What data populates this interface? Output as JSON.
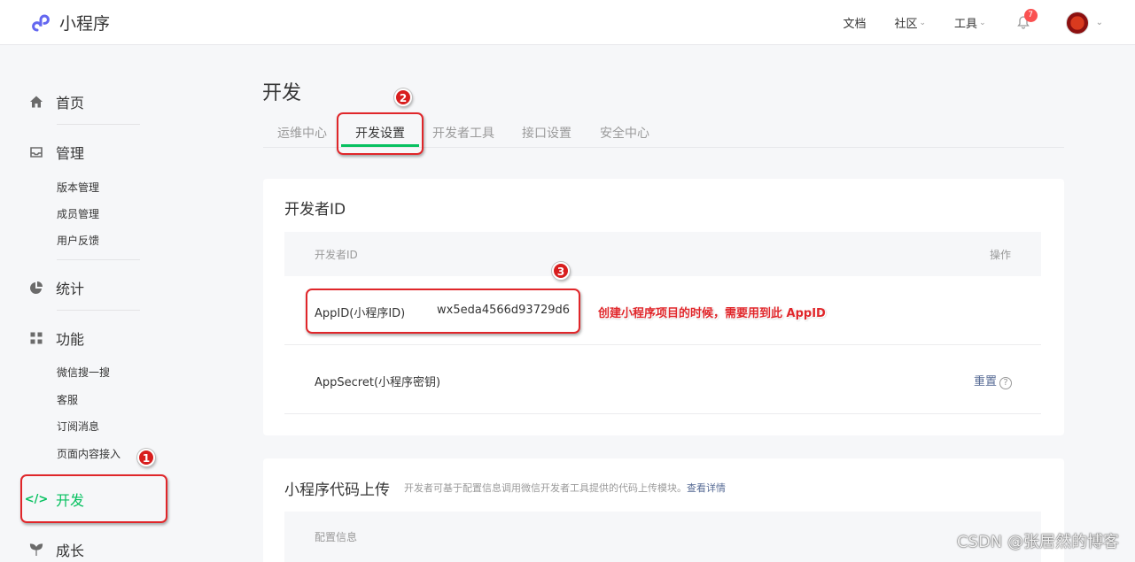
{
  "app": {
    "title": "小程序"
  },
  "topnav": {
    "docs": "文档",
    "community": "社区",
    "tools": "工具",
    "notification_count": "7"
  },
  "sidebar": {
    "home": "首页",
    "manage": "管理",
    "manage_items": [
      "版本管理",
      "成员管理",
      "用户反馈"
    ],
    "stats": "统计",
    "features": "功能",
    "feature_items": [
      "微信搜一搜",
      "客服",
      "订阅消息",
      "页面内容接入"
    ],
    "develop": "开发",
    "growth": "成长"
  },
  "page": {
    "title": "开发",
    "tabs": [
      "运维中心",
      "开发设置",
      "开发者工具",
      "接口设置",
      "安全中心"
    ],
    "active_tab": "开发设置"
  },
  "dev_id_card": {
    "title": "开发者ID",
    "col_id": "开发者ID",
    "col_action": "操作",
    "rows": [
      {
        "label": "AppID(小程序ID)",
        "value": "wx5eda4566d93729d6",
        "action": ""
      },
      {
        "label": "AppSecret(小程序密钥)",
        "value": "",
        "action": "重置"
      }
    ]
  },
  "upload_card": {
    "title": "小程序代码上传",
    "desc": "开发者可基于配置信息调用微信开发者工具提供的代码上传模块。",
    "link": "查看详情",
    "col_config": "配置信息"
  },
  "annotations": {
    "step1": "1",
    "step2": "2",
    "step3": "3",
    "note": "创建小程序项目的时候，需要用到此 AppID",
    "color": "#e0262a"
  },
  "watermark": "CSDN @张居然的博客",
  "colors": {
    "accent": "#07c160",
    "link": "#576b95",
    "text": "#353535",
    "muted": "#9a9a9a"
  }
}
